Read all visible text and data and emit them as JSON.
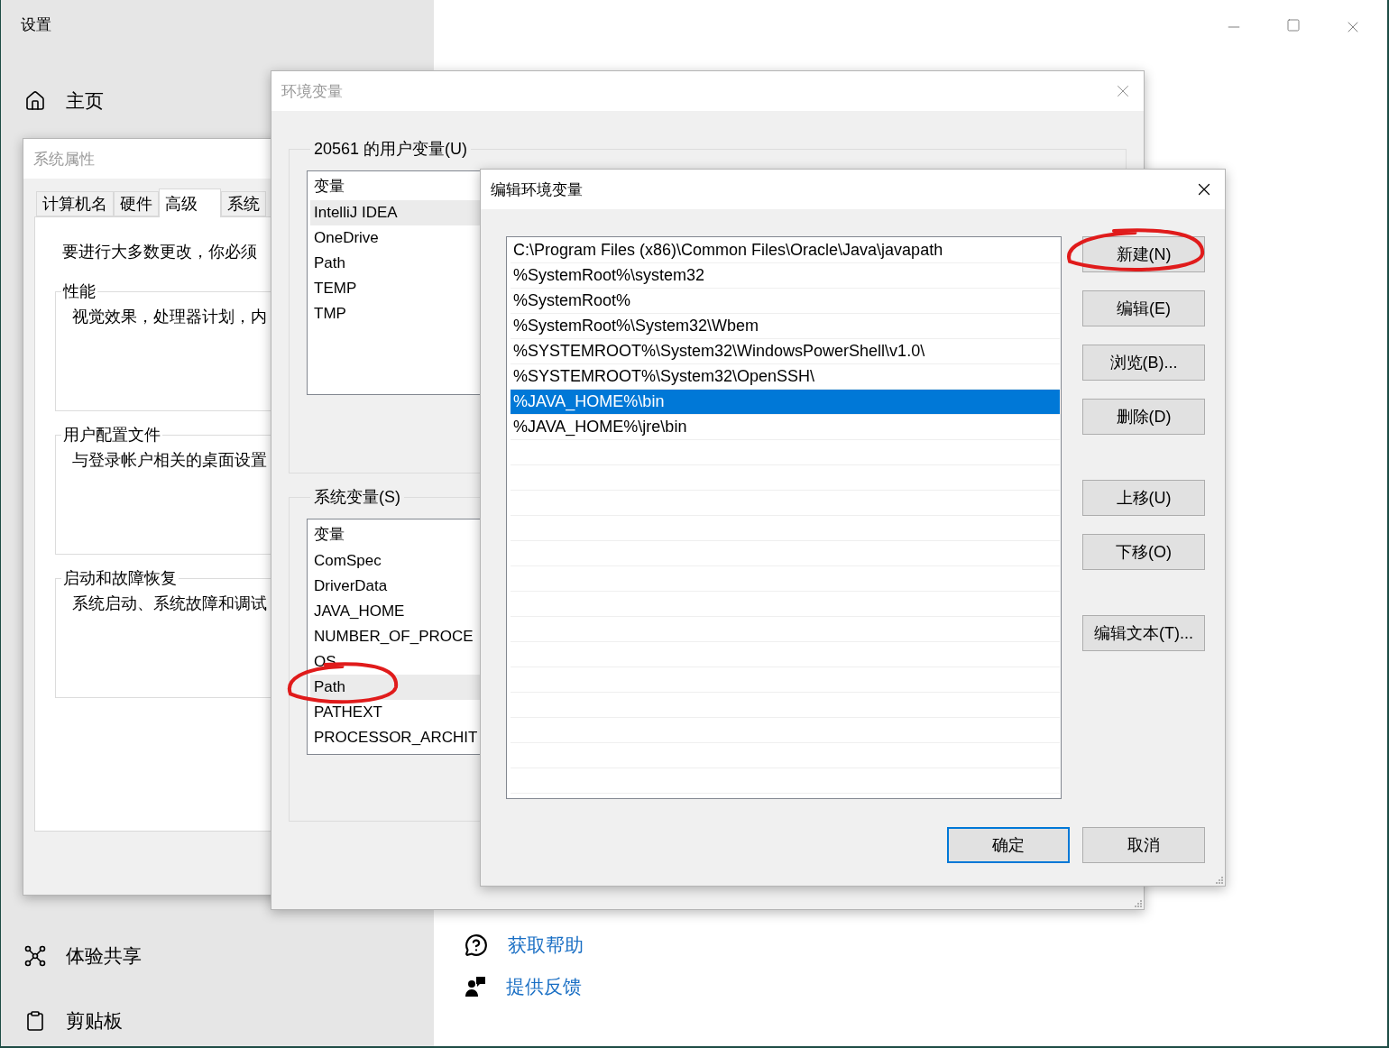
{
  "settings": {
    "title": "设置",
    "home": {
      "label": "主页",
      "kind": "home"
    },
    "nav": [
      {
        "label": "体验共享",
        "kind": "share"
      },
      {
        "label": "剪贴板",
        "kind": "clipboard"
      }
    ],
    "links": [
      {
        "label": "获取帮助",
        "kind": "help"
      },
      {
        "label": "提供反馈",
        "kind": "feedback"
      }
    ]
  },
  "system_properties": {
    "title": "系统属性",
    "tabs": [
      {
        "label": "计算机名",
        "selected": false
      },
      {
        "label": "硬件",
        "selected": false
      },
      {
        "label": "高级",
        "selected": true
      },
      {
        "label": "系统",
        "selected": false
      }
    ],
    "notice": "要进行大多数更改，你必须",
    "groups": [
      {
        "title": "性能",
        "text": "视觉效果，处理器计划，内"
      },
      {
        "title": "用户配置文件",
        "text": "与登录帐户相关的桌面设置"
      },
      {
        "title": "启动和故障恢复",
        "text": "系统启动、系统故障和调试"
      }
    ]
  },
  "environment_variables": {
    "title": "环境变量",
    "user_group": {
      "title": "20561 的用户变量(U)",
      "column": "变量",
      "rows": [
        {
          "name": "IntelliJ IDEA",
          "selected": true
        },
        {
          "name": "OneDrive",
          "selected": false
        },
        {
          "name": "Path",
          "selected": false
        },
        {
          "name": "TEMP",
          "selected": false
        },
        {
          "name": "TMP",
          "selected": false
        }
      ]
    },
    "system_group": {
      "title": "系统变量(S)",
      "column": "变量",
      "rows": [
        {
          "name": "ComSpec",
          "selected": false
        },
        {
          "name": "DriverData",
          "selected": false
        },
        {
          "name": "JAVA_HOME",
          "selected": false
        },
        {
          "name": "NUMBER_OF_PROCE",
          "selected": false
        },
        {
          "name": "OS",
          "selected": false
        },
        {
          "name": "Path",
          "selected": true
        },
        {
          "name": "PATHEXT",
          "selected": false
        },
        {
          "name": "PROCESSOR_ARCHIT",
          "selected": false
        }
      ]
    }
  },
  "edit_dialog": {
    "title": "编辑环境变量",
    "entries": [
      {
        "text": "C:\\Program Files (x86)\\Common Files\\Oracle\\Java\\javapath",
        "selected": false
      },
      {
        "text": "%SystemRoot%\\system32",
        "selected": false
      },
      {
        "text": "%SystemRoot%",
        "selected": false
      },
      {
        "text": "%SystemRoot%\\System32\\Wbem",
        "selected": false
      },
      {
        "text": "%SYSTEMROOT%\\System32\\WindowsPowerShell\\v1.0\\",
        "selected": false
      },
      {
        "text": "%SYSTEMROOT%\\System32\\OpenSSH\\",
        "selected": false
      },
      {
        "text": "%JAVA_HOME%\\bin",
        "selected": true
      },
      {
        "text": "%JAVA_HOME%\\jre\\bin",
        "selected": false
      }
    ],
    "side_buttons": [
      [
        "新建(N)",
        "编辑(E)",
        "浏览(B)...",
        "删除(D)"
      ],
      [
        "上移(U)",
        "下移(O)"
      ],
      [
        "编辑文本(T)..."
      ]
    ],
    "ok": "确定",
    "cancel": "取消"
  }
}
